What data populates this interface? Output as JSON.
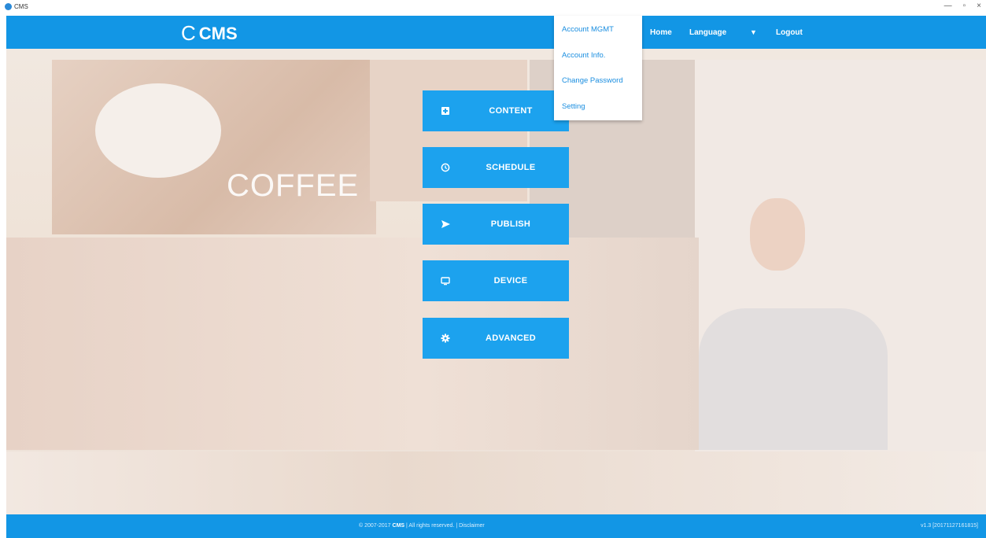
{
  "window": {
    "title": "CMS",
    "minimize": "—",
    "maximize": "▫",
    "close": "×"
  },
  "header": {
    "logo_mark": "C",
    "logo_text": "CMS",
    "nav": {
      "home": "Home",
      "language": "Language",
      "language_caret": "▼",
      "logout": "Logout"
    }
  },
  "dropdown": {
    "items": [
      "Account MGMT",
      "Account Info.",
      "Change Password",
      "Setting"
    ]
  },
  "background": {
    "coffee_text": "COFFEE"
  },
  "menu": [
    {
      "label": "CONTENT",
      "icon": "content-icon"
    },
    {
      "label": "SCHEDULE",
      "icon": "clock-icon"
    },
    {
      "label": "PUBLISH",
      "icon": "send-icon"
    },
    {
      "label": "DEVICE",
      "icon": "monitor-icon"
    },
    {
      "label": "ADVANCED",
      "icon": "gear-icon"
    }
  ],
  "footer": {
    "copyright_prefix": "© 2007-2017",
    "brand": "CMS",
    "copyright_suffix": "| All rights reserved. | Disclaimer",
    "version": "v1.3 [20171127161815]"
  },
  "colors": {
    "brand_blue": "#1296e5",
    "button_blue": "#1ca2ee",
    "link_blue": "#1a8ee0"
  }
}
